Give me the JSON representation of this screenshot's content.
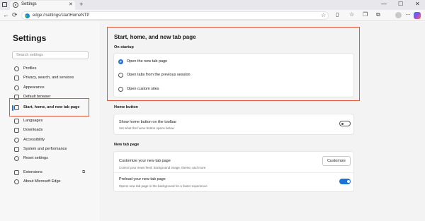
{
  "browser": {
    "tab_title": "Settings",
    "tab_close_glyph": "✕",
    "new_tab_glyph": "+",
    "window_controls": [
      "—",
      "☐",
      "✕"
    ],
    "back_glyph": "←",
    "refresh_glyph": "⟳",
    "url": "edge://settings/startHomeNTP",
    "toolbar_icons": [
      "favorites-star-icon",
      "split-screen-icon",
      "favorites-icon",
      "collections-icon",
      "profile-icon",
      "more-icon",
      "copilot-icon"
    ],
    "colors": {
      "accent": "#1a73d9",
      "highlight_box": "#e4583a"
    }
  },
  "sidebar": {
    "title": "Settings",
    "search_placeholder": "Search settings",
    "items": [
      {
        "label": "Profiles",
        "icon": "profile-icon",
        "active": false
      },
      {
        "label": "Privacy, search, and services",
        "icon": "lock-icon",
        "active": false
      },
      {
        "label": "Appearance",
        "icon": "appearance-icon",
        "active": false
      },
      {
        "label": "Default browser",
        "icon": "browser-icon",
        "active": false
      },
      {
        "label": "Start, home, and new tab page",
        "icon": "home-tab-icon",
        "active": true
      },
      {
        "label": "Languages",
        "icon": "languages-icon",
        "active": false
      },
      {
        "label": "Downloads",
        "icon": "download-icon",
        "active": false
      },
      {
        "label": "Accessibility",
        "icon": "accessibility-icon",
        "active": false
      },
      {
        "label": "System and performance",
        "icon": "system-icon",
        "active": false
      },
      {
        "label": "Reset settings",
        "icon": "reset-icon",
        "active": false
      },
      {
        "label": "Extensions",
        "icon": "extensions-icon",
        "active": false
      },
      {
        "label": "About Microsoft Edge",
        "icon": "edge-icon",
        "active": false
      }
    ]
  },
  "main": {
    "page_title": "Start, home, and new tab page",
    "on_startup": {
      "label": "On startup",
      "options": [
        {
          "label": "Open the new tab page",
          "selected": true
        },
        {
          "label": "Open tabs from the previous session",
          "selected": false
        },
        {
          "label": "Open custom sites",
          "selected": false
        }
      ]
    },
    "home_button": {
      "label": "Home button",
      "row_title": "Show home button on the toolbar",
      "row_sub": "Set what the home button opens below",
      "toggle_on": false
    },
    "new_tab_page": {
      "label": "New tab page",
      "customize_title": "Customize your new tab page",
      "customize_sub": "Control your news feed, background image, theme, and more",
      "customize_button": "Customize",
      "preload_title": "Preload your new tab page",
      "preload_sub": "Opens new tab page in the background for a faster experience",
      "preload_on": true
    }
  }
}
